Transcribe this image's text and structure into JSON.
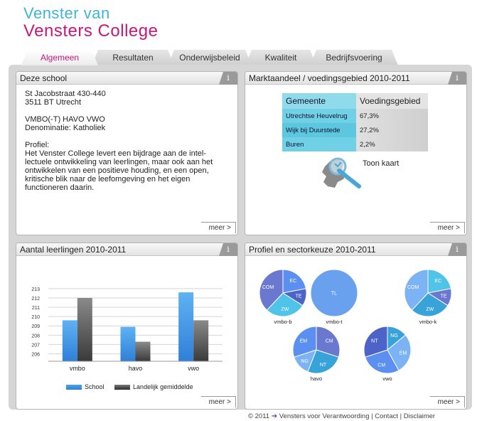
{
  "brand": {
    "line1": "Venster van",
    "line2": "Vensters College"
  },
  "tabs": [
    "Algemeen",
    "Resultaten",
    "Onderwijsbeleid",
    "Kwaliteit",
    "Bedrijfsvoering"
  ],
  "panels": {
    "school": {
      "title": "Deze school",
      "info": "i",
      "address1": "St Jacobstraat 430-440",
      "address2": "3511 BT Utrecht",
      "levels": "VMBO(-T) HAVO VWO",
      "denomination": "Denominatie: Katholiek",
      "profile_heading": "Profiel:",
      "profile_text": "Het Venster College levert een bijdrage aan de intel-lectuele ontwikkeling van leerlingen, maar ook aan het ontwikkelen van een positieve houding, en een open, kritische blik naar de leefomgeving en het eigen functioneren daarin.",
      "more": "meer >"
    },
    "market": {
      "title": "Marktaandeel / voedingsgebied 2010-2011",
      "info": "i",
      "headers": [
        "Gemeente",
        "Voedingsgebied"
      ],
      "rows": [
        [
          "Utrechtse Heuvelrug",
          "67,3%"
        ],
        [
          "Wijk bij Duurstede",
          "27,2%"
        ],
        [
          "Buren",
          "2,2%"
        ]
      ],
      "map_link": "Toon kaart",
      "more": "meer >"
    },
    "students": {
      "title": "Aantal leerlingen 2010-2011",
      "info": "i",
      "more": "meer >"
    },
    "profile": {
      "title": "Profiel en sectorkeuze 2010-2011",
      "info": "i",
      "more": "meer >"
    }
  },
  "chart_data": {
    "type": "bar",
    "categories": [
      "vmbo",
      "havo",
      "vwo"
    ],
    "series": [
      {
        "name": "School",
        "values": [
          209.6,
          208.9,
          212.6
        ],
        "color": "#2f7fd9"
      },
      {
        "name": "Landelijk gemiddelde",
        "values": [
          212.0,
          207.3,
          209.6
        ],
        "color": "#3a3a3a"
      }
    ],
    "yticks": [
      206,
      207,
      208,
      209,
      210,
      211,
      212,
      213
    ],
    "ylim": [
      205.2,
      213.6
    ],
    "grid": true,
    "legend": "bottom"
  },
  "pies": [
    {
      "name": "vmbo-b",
      "slices": [
        {
          "label": "EC",
          "value": 22
        },
        {
          "label": "TE",
          "value": 12
        },
        {
          "label": "ZW",
          "value": 28
        },
        {
          "label": "COM",
          "value": 38
        }
      ]
    },
    {
      "name": "vmbo-t",
      "slices": [
        {
          "label": "TL",
          "value": 100
        }
      ]
    },
    {
      "name": "vmbo-k",
      "slices": [
        {
          "label": "EC",
          "value": 22
        },
        {
          "label": "TE",
          "value": 12
        },
        {
          "label": "ZW",
          "value": 28
        },
        {
          "label": "COM",
          "value": 38
        }
      ]
    },
    {
      "name": "havo",
      "slices": [
        {
          "label": "CM",
          "value": 30
        },
        {
          "label": "NT",
          "value": 26
        },
        {
          "label": "NG",
          "value": 14
        },
        {
          "label": "EM",
          "value": 30
        }
      ]
    },
    {
      "name": "vwo",
      "slices": [
        {
          "label": "NG",
          "value": 14
        },
        {
          "label": "EM",
          "value": 28
        },
        {
          "label": "CM",
          "value": 28
        },
        {
          "label": "NT",
          "value": 30
        }
      ]
    }
  ],
  "colors": {
    "accent_pink": "#c8167a",
    "accent_blue": "#3fb4d6",
    "tab_active": "#c8167a"
  },
  "footer": {
    "copyright": "© 2011",
    "brand": "Vensters voor Verantwoording",
    "sep1": "|",
    "contact": "Contact",
    "sep2": "|",
    "disclaimer": "Disclaimer"
  }
}
